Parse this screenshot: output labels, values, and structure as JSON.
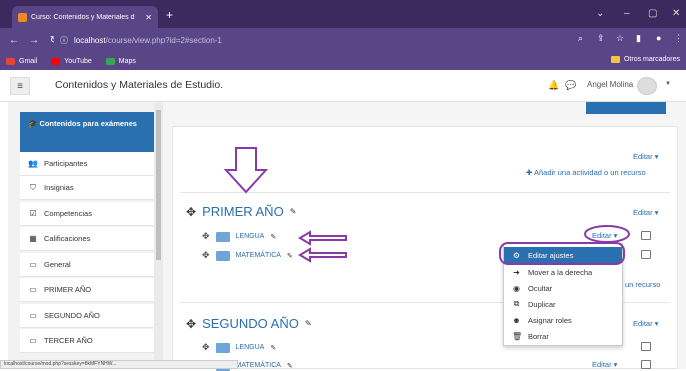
{
  "browser": {
    "tab_title": "Curso: Contenidos y Materiales d",
    "tab_close": "✕",
    "new_tab": "+",
    "url_host": "localhost",
    "url_path": "/course/view.php?id=2#section-1",
    "bookmarks": [
      {
        "label": "Gmail",
        "color": "#e94335"
      },
      {
        "label": "YouTube",
        "color": "#ff0000"
      },
      {
        "label": "Maps",
        "color": "#34a853"
      }
    ],
    "other_bookmarks": "Otros marcadores"
  },
  "header": {
    "site_name": "Contenidos y Materiales de Estudio.",
    "user_name": "Angel Molina"
  },
  "drawer": {
    "active_item": "Contenidos para exámenes",
    "items": [
      {
        "label": "Participantes",
        "icon": "users-icon"
      },
      {
        "label": "Insignias",
        "icon": "shield-icon"
      },
      {
        "label": "Competencias",
        "icon": "checkbox-icon"
      },
      {
        "label": "Calificaciones",
        "icon": "table-icon"
      },
      {
        "label": "General",
        "icon": "folder-icon"
      },
      {
        "label": "PRIMER AÑO",
        "icon": "folder-icon"
      },
      {
        "label": "SEGUNDO AÑO",
        "icon": "folder-icon"
      },
      {
        "label": "TERCER AÑO",
        "icon": "folder-icon"
      }
    ]
  },
  "content": {
    "edit_label": "Editar ▾",
    "add_activity": "Añadir una actividad o un recurso",
    "add_activity_partial": "un recurso",
    "sections": [
      {
        "title": "PRIMER AÑO",
        "activities": [
          "LENGUA",
          "MATEMÁTICA"
        ]
      },
      {
        "title": "SEGUNDO AÑO",
        "activities": [
          "LENGUA",
          "MATEMÁTICA"
        ]
      }
    ]
  },
  "edit_menu": {
    "items": [
      {
        "label": "Editar ajustes",
        "icon": "gear-icon",
        "highlighted": true
      },
      {
        "label": "Mover a la derecha",
        "icon": "arrow-right-icon"
      },
      {
        "label": "Ocultar",
        "icon": "eye-icon"
      },
      {
        "label": "Duplicar",
        "icon": "copy-icon"
      },
      {
        "label": "Asignar roles",
        "icon": "user-icon"
      },
      {
        "label": "Borrar",
        "icon": "trash-icon"
      }
    ]
  },
  "status_bar": "localhost/course/mod.php?sesskey=8kMFYNHW..."
}
